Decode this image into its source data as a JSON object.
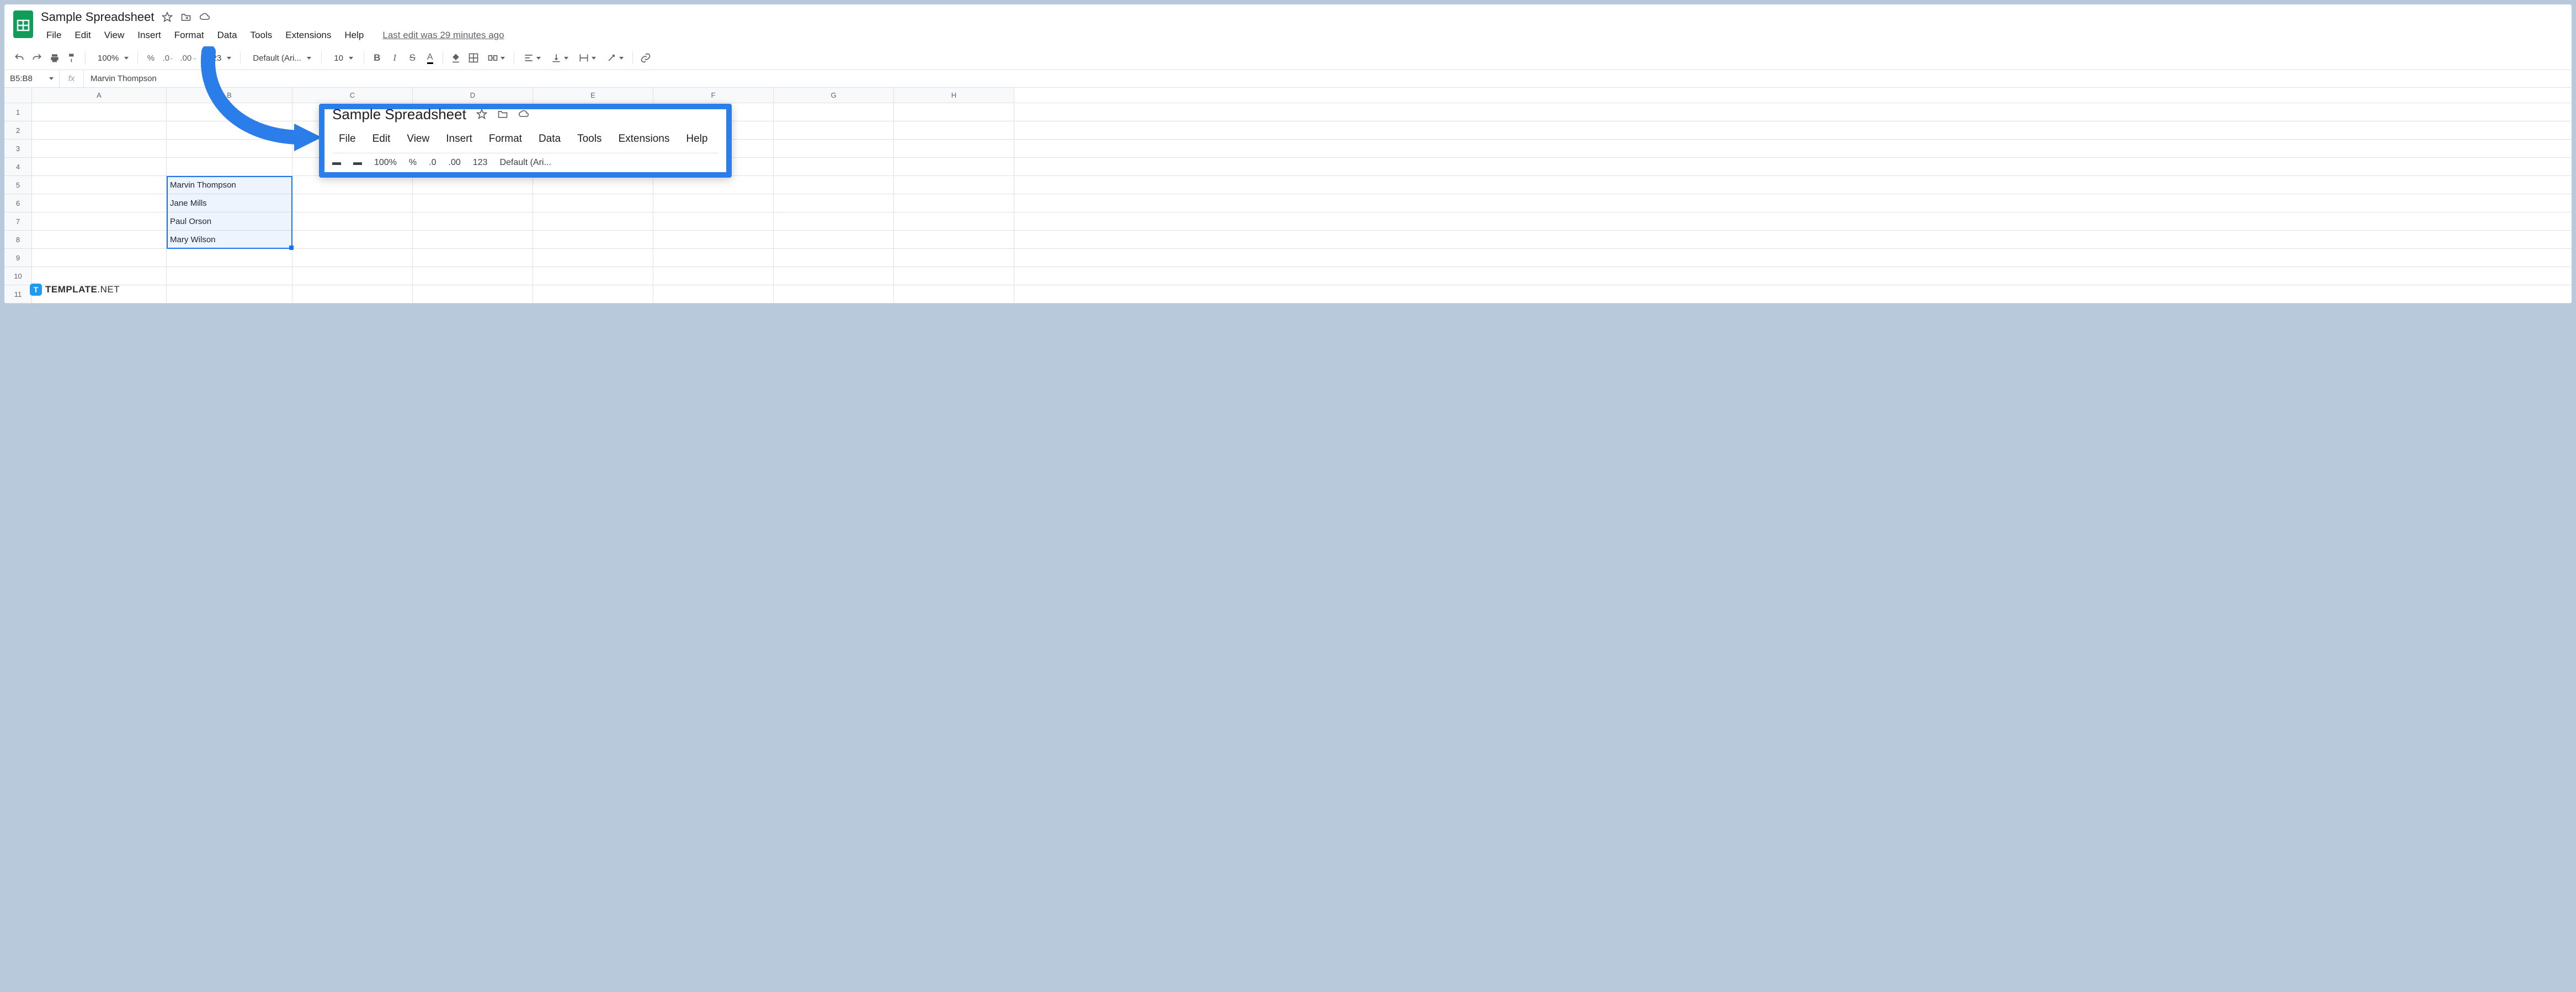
{
  "header": {
    "title": "Sample Spreadsheet",
    "last_edit": "Last edit was 29 minutes ago",
    "menus": [
      "File",
      "Edit",
      "View",
      "Insert",
      "Format",
      "Data",
      "Tools",
      "Extensions",
      "Help"
    ]
  },
  "toolbar": {
    "zoom": "100%",
    "percent": "%",
    "dec0": ".0",
    "dec00": ".00",
    "num123": "123",
    "font": "Default (Ari...",
    "font_size": "10"
  },
  "formula": {
    "range": "B5:B8",
    "fx": "fx",
    "value": "Marvin Thompson"
  },
  "columns": [
    "A",
    "B",
    "C",
    "D",
    "E",
    "F",
    "G",
    "H"
  ],
  "rows": [
    1,
    2,
    3,
    4,
    5,
    6,
    7,
    8,
    9,
    10,
    11
  ],
  "cells": {
    "B5": "Marvin Thompson",
    "B6": "Jane Mills",
    "B7": "Paul Orson",
    "B8": "Mary Wilson"
  },
  "callout": {
    "title": "Sample Spreadsheet",
    "menus": [
      "File",
      "Edit",
      "View",
      "Insert",
      "Format",
      "Data",
      "Tools",
      "Extensions",
      "Help"
    ],
    "tb_items": [
      "100%",
      "%",
      ".0",
      ".00",
      "123",
      "Default (Ari..."
    ]
  },
  "watermark": {
    "badge": "T",
    "brand": "TEMPLATE",
    "suffix": ".NET"
  }
}
